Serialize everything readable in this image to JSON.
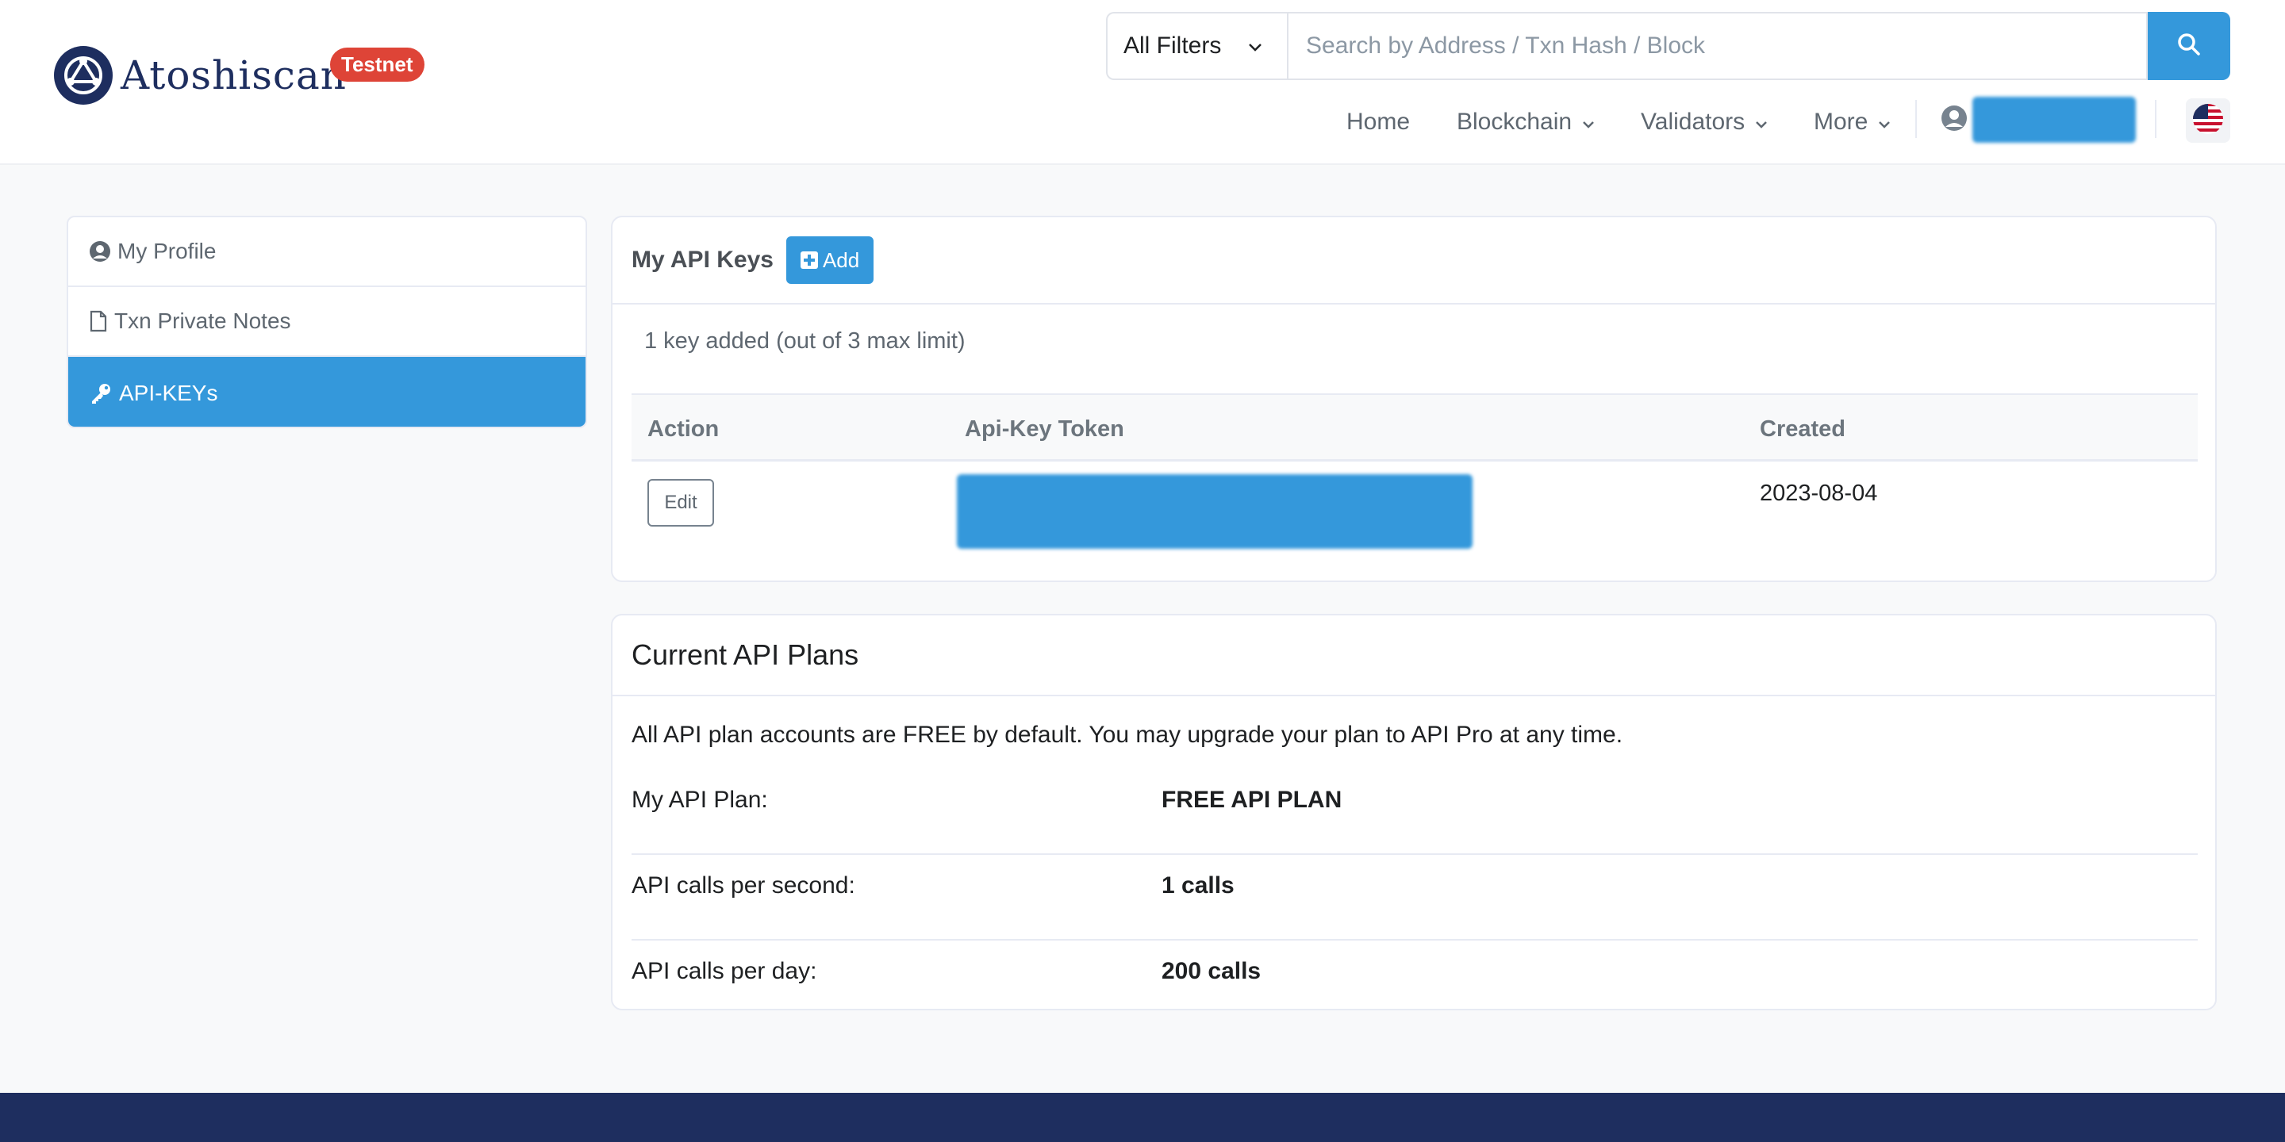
{
  "header": {
    "brand_name": "Atoshiscan",
    "network_badge": "Testnet",
    "filter_label": "All Filters",
    "search_placeholder": "Search by Address / Txn Hash / Block",
    "nav": {
      "home": "Home",
      "blockchain": "Blockchain",
      "validators": "Validators",
      "more": "More"
    }
  },
  "sidebar": {
    "items": [
      {
        "label": "My Profile",
        "icon": "user-circle-icon"
      },
      {
        "label": "Txn Private Notes",
        "icon": "document-icon"
      },
      {
        "label": "API-KEYs",
        "icon": "key-icon",
        "active": true
      }
    ]
  },
  "api_keys": {
    "title": "My API Keys",
    "add_label": "Add",
    "count_text": "1 key added (out of 3 max limit)",
    "columns": {
      "action": "Action",
      "token": "Api-Key Token",
      "created": "Created"
    },
    "rows": [
      {
        "action_label": "Edit",
        "created": "2023-08-04"
      }
    ]
  },
  "plans": {
    "title": "Current API Plans",
    "intro": "All API plan accounts are FREE by default. You may upgrade your plan to API Pro at any time.",
    "rows": [
      {
        "label": "My API Plan:",
        "value": "FREE API PLAN"
      },
      {
        "label": "API calls per second:",
        "value": "1 calls"
      },
      {
        "label": "API calls per day:",
        "value": "200 calls"
      }
    ]
  },
  "colors": {
    "primary": "#3498db",
    "navy": "#1e2e5f",
    "badge_red": "#de4437"
  }
}
